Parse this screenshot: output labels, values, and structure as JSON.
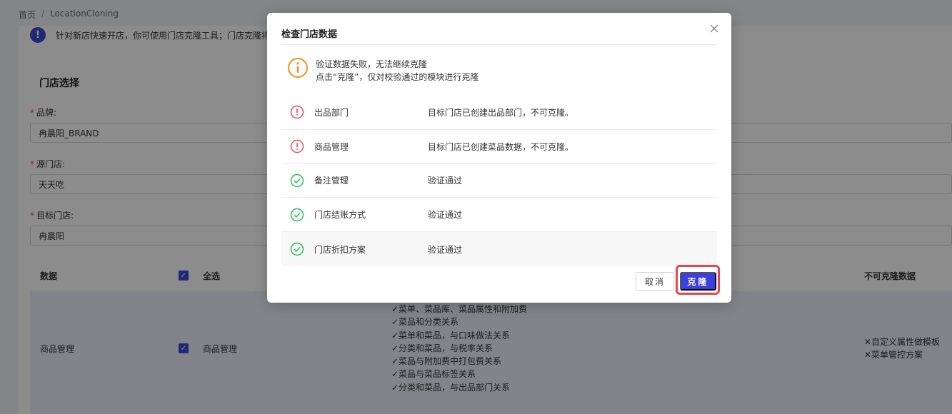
{
  "breadcrumb": {
    "home": "首页",
    "separator": "/",
    "current": "LocationCloning"
  },
  "notice": {
    "text": "针对新店快速开店，你可使用门店克隆工具；门店克隆将对"
  },
  "form": {
    "section_title": "门店选择",
    "brand_label": "品牌:",
    "brand_value": "冉晨阳_BRAND",
    "source_label": "源门店:",
    "source_value": "天天吃",
    "target_label": "目标门店:",
    "target_value": "冉晨阳",
    "required_mark": "*"
  },
  "table": {
    "col_data": "数据",
    "col_select_all": "全选",
    "col_nonclone": "不可克隆数据",
    "row": {
      "name": "商品管理",
      "checkbox_label": "商品管理",
      "clone_items": [
        "✓菜单、菜品库、菜品属性和附加费",
        "✓菜品和分类关系",
        "✓菜单和菜品，与口味做法关系",
        "✓分类和菜品，与税率关系",
        "✓菜品与附加费中打包费关系",
        "✓菜品与菜品标签关系",
        "✓分类和菜品，与出品部门关系"
      ],
      "nonclone_items": [
        "✕自定义属性做模板",
        "✕菜单管控方案"
      ]
    }
  },
  "modal": {
    "title": "检查门店数据",
    "warn_line1": "验证数据失败，无法继续克隆",
    "warn_line2": "点击“克隆”，仅对校验通过的模块进行克隆",
    "results": [
      {
        "name": "出品部门",
        "message": "目标门店已创建出品部门，不可克隆。",
        "status": "error"
      },
      {
        "name": "商品管理",
        "message": "目标门店已创建菜品数据，不可克隆。",
        "status": "error"
      },
      {
        "name": "备注管理",
        "message": "验证通过",
        "status": "pass"
      },
      {
        "name": "门店结账方式",
        "message": "验证通过",
        "status": "pass"
      },
      {
        "name": "门店折扣方案",
        "message": "验证通过",
        "status": "pass"
      }
    ],
    "cancel_label": "取消",
    "clone_label": "克隆"
  },
  "colors": {
    "accent": "#3b3fe0",
    "error": "#e34d59",
    "success": "#2bbf5c",
    "warn": "#f0901a",
    "highlight": "#e0484d"
  }
}
